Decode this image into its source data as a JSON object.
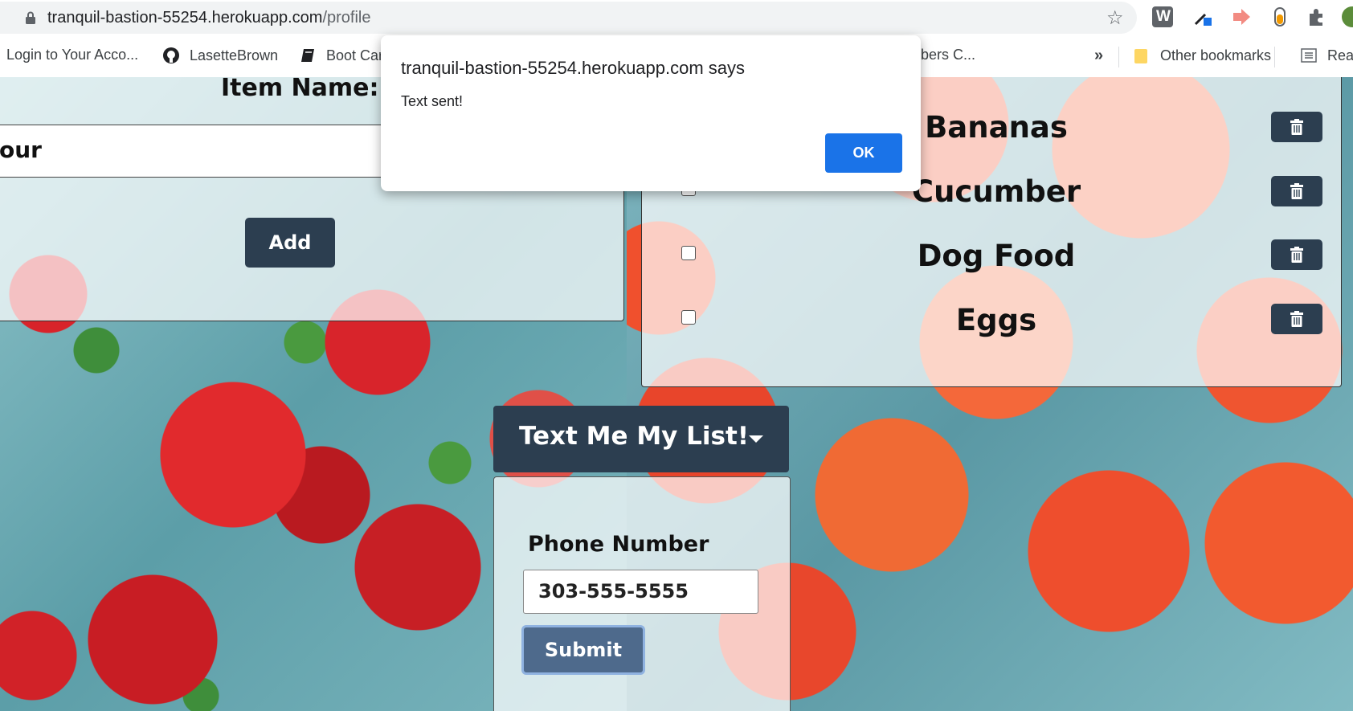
{
  "browser": {
    "url_host": "tranquil-bastion-55254.herokuapp.com",
    "url_path": "/profile",
    "bookmarks": [
      {
        "label": "Login to Your Acco..."
      },
      {
        "label": "LasetteBrown"
      },
      {
        "label": "Boot Car"
      },
      {
        "label": "nbers C..."
      },
      {
        "label": "Other bookmarks"
      },
      {
        "label": "Rea"
      }
    ],
    "overflow_label": "»",
    "extension_w_label": "W"
  },
  "form": {
    "item_name_label": "Item Name:",
    "item_input_value": "our",
    "add_label": "Add"
  },
  "list": {
    "items": [
      {
        "name": "Bananas",
        "checked": false
      },
      {
        "name": "Cucumber",
        "checked": false
      },
      {
        "name": "Dog Food",
        "checked": false
      },
      {
        "name": "Eggs",
        "checked": false
      }
    ]
  },
  "text_me": {
    "dropdown_label": "Text Me My List!",
    "phone_label": "Phone Number",
    "phone_value": "303-555-5555",
    "submit_label": "Submit"
  },
  "dialog": {
    "title": "tranquil-bastion-55254.herokuapp.com says",
    "message": "Text sent!",
    "ok_label": "OK"
  },
  "colors": {
    "dark_button": "#2c3e50",
    "dialog_button": "#1a73e8",
    "submit_button": "#4e6a8c"
  }
}
